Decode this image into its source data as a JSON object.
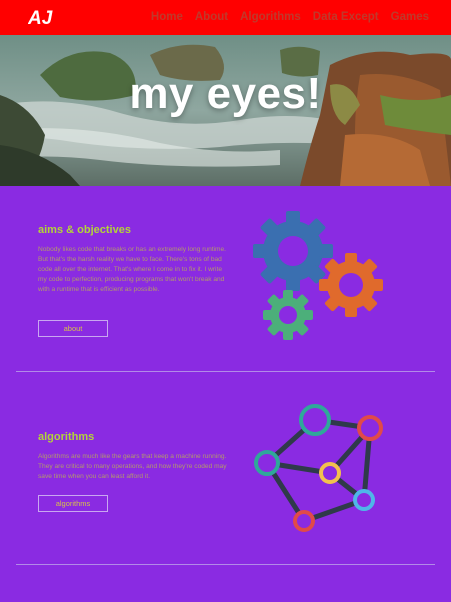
{
  "nav": {
    "logo": "AJ",
    "links": [
      "Home",
      "About",
      "Algorithms",
      "Data Except",
      "Games"
    ]
  },
  "hero": {
    "title": "my eyes!"
  },
  "sections": [
    {
      "title": "aims & objectives",
      "body": "Nobody likes code that breaks or has an extremely long runtime. But that's the harsh reality we have to face. There's tons of bad code all over the internet. That's where I come in to fix it. I write my code to perfection, producing programs that won't break and with a runtime that is efficient as possible.",
      "button": "about",
      "image_icon": "gears-icon"
    },
    {
      "title": "algorithms",
      "body": "Algorithms are much like the gears that keep a machine running. They are critical to many operations, and how they're coded may save time when you can least afford it.",
      "button": "algorithms",
      "image_icon": "network-graph-icon"
    }
  ],
  "colors": {
    "nav_bg": "#ff0000",
    "page_bg": "#8a2be2",
    "heading": "#b3d33a",
    "body_text": "#b39a6b",
    "button_text": "#d7c24a"
  }
}
